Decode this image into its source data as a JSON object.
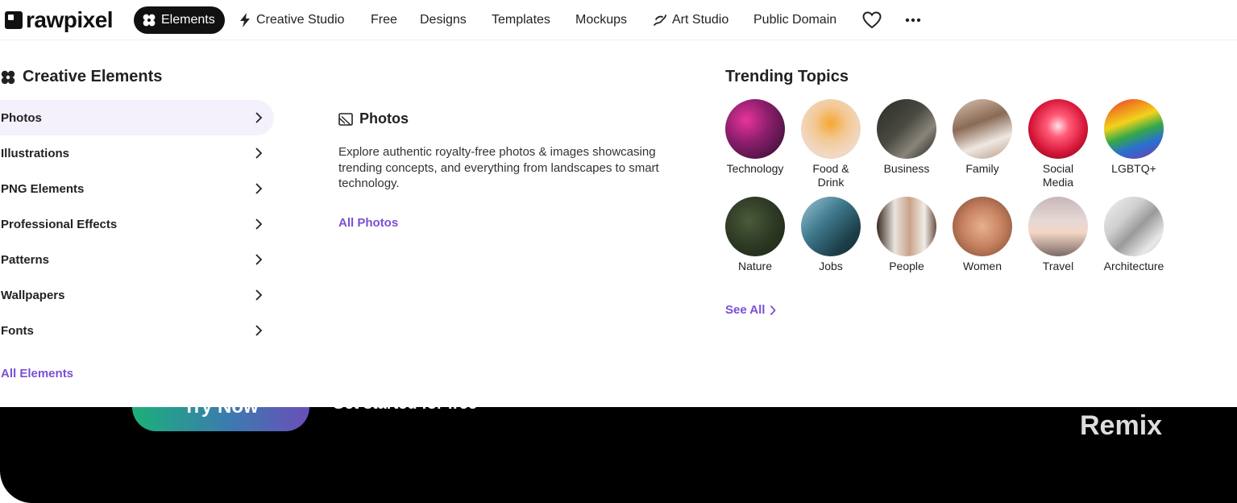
{
  "brand": {
    "name": "rawpixel"
  },
  "nav": {
    "items": [
      {
        "label": "Elements",
        "icon": "flower-icon"
      },
      {
        "label": "Creative Studio",
        "icon": "bolt-icon"
      },
      {
        "label": "Free"
      },
      {
        "label": "Designs"
      },
      {
        "label": "Templates"
      },
      {
        "label": "Mockups"
      },
      {
        "label": "Art Studio",
        "icon": "brush-icon"
      },
      {
        "label": "Public Domain"
      }
    ],
    "icons": [
      "heart-icon",
      "more-icon"
    ]
  },
  "menu": {
    "title": "Creative Elements",
    "categories": [
      {
        "label": "Photos",
        "active": true
      },
      {
        "label": "Illustrations"
      },
      {
        "label": "PNG Elements"
      },
      {
        "label": "Professional Effects"
      },
      {
        "label": "Patterns"
      },
      {
        "label": "Wallpapers"
      },
      {
        "label": "Fonts"
      }
    ],
    "all_link": "All Elements"
  },
  "detail": {
    "title": "Photos",
    "description": "Explore authentic royalty-free photos & images showcasing trending concepts, and everything from landscapes to smart technology.",
    "link": "All Photos"
  },
  "trending": {
    "title": "Trending Topics",
    "topics": [
      {
        "label": "Technology"
      },
      {
        "label": "Food & Drink"
      },
      {
        "label": "Business"
      },
      {
        "label": "Family"
      },
      {
        "label": "Social Media"
      },
      {
        "label": "LGBTQ+"
      },
      {
        "label": "Nature"
      },
      {
        "label": "Jobs"
      },
      {
        "label": "People"
      },
      {
        "label": "Women"
      },
      {
        "label": "Travel"
      },
      {
        "label": "Architecture"
      }
    ],
    "see_all": "See All"
  },
  "banner": {
    "button": "Try Now",
    "tagline": "Get started for free",
    "remix": "Remix"
  },
  "colors": {
    "accent": "#7b4fd6",
    "active_bg": "#f4f1fd",
    "nav_pill": "#111111"
  }
}
